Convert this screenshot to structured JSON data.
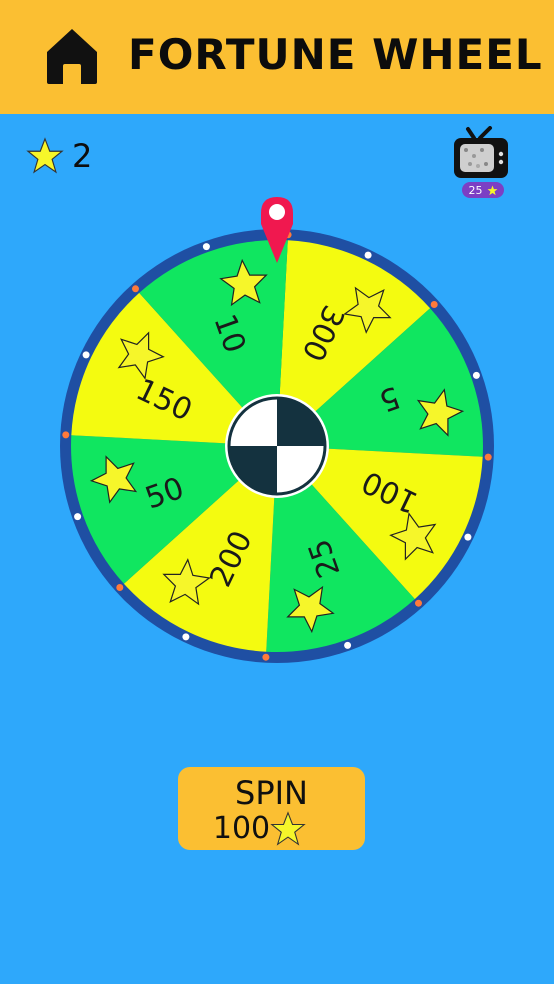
{
  "header": {
    "title": "FORTUNE WHEEL",
    "home_icon": "home-icon"
  },
  "player": {
    "stars": "2"
  },
  "ad_reward": {
    "icon": "tv-icon",
    "amount": "25"
  },
  "wheel": {
    "segments": [
      {
        "value": "300",
        "color": "#f4fb10"
      },
      {
        "value": "5",
        "color": "#10e660"
      },
      {
        "value": "100",
        "color": "#f4fb10"
      },
      {
        "value": "25",
        "color": "#10e660"
      },
      {
        "value": "200",
        "color": "#f4fb10"
      },
      {
        "value": "50",
        "color": "#10e660"
      },
      {
        "value": "150",
        "color": "#f4fb10"
      },
      {
        "value": "10",
        "color": "#10e660"
      }
    ],
    "rim_color": "#1f4fa3",
    "pointer_color": "#f0184f"
  },
  "spin_button": {
    "label": "SPIN",
    "cost": "100"
  },
  "colors": {
    "background": "#2ea8fb",
    "header": "#fbbf32",
    "star": "#f6f62a"
  }
}
